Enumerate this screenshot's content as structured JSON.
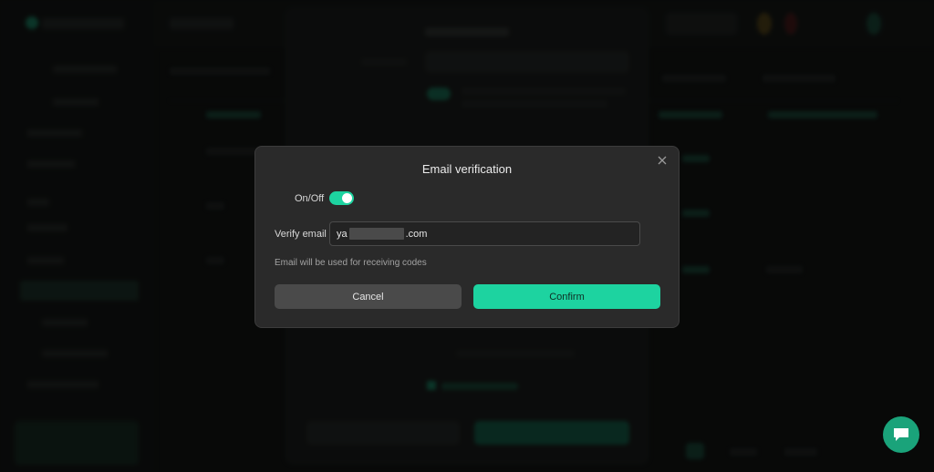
{
  "modal": {
    "title": "Email verification",
    "toggle_label": "On/Off",
    "toggle_on": true,
    "email_label": "Verify email",
    "email_prefix": "ya",
    "email_suffix": ".com",
    "hint": "Email will be used for receiving codes",
    "cancel_label": "Cancel",
    "confirm_label": "Confirm",
    "close_icon": "close-icon"
  },
  "chat": {
    "icon": "chat-bubble-icon"
  },
  "colors": {
    "accent": "#1dd3a0",
    "modal_bg": "#2a2a2a",
    "cancel_bg": "#4a4a4a",
    "chat_bg": "#1aa37a"
  }
}
